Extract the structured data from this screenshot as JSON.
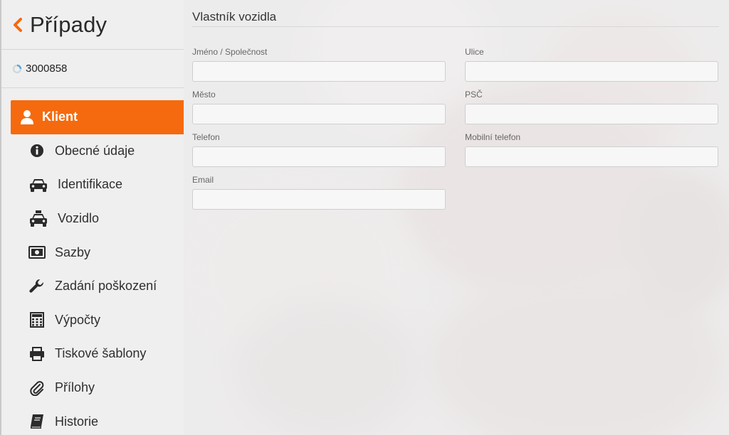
{
  "sidebar": {
    "title": "Případy",
    "case_id": "3000858",
    "items": [
      {
        "label": "Klient",
        "icon": "user-icon",
        "active": true
      },
      {
        "label": "Obecné údaje",
        "icon": "info-circle-icon",
        "active": false
      },
      {
        "label": "Identifikace",
        "icon": "car-icon",
        "active": false
      },
      {
        "label": "Vozidlo",
        "icon": "taxi-icon",
        "active": false
      },
      {
        "label": "Sazby",
        "icon": "money-icon",
        "active": false
      },
      {
        "label": "Zadání poškození",
        "icon": "wrench-icon",
        "active": false
      },
      {
        "label": "Výpočty",
        "icon": "calculator-icon",
        "active": false
      },
      {
        "label": "Tiskové šablony",
        "icon": "print-icon",
        "active": false
      },
      {
        "label": "Přílohy",
        "icon": "paperclip-icon",
        "active": false
      },
      {
        "label": "Historie",
        "icon": "book-icon",
        "active": false
      }
    ]
  },
  "main": {
    "section_title": "Vlastník vozidla",
    "fields": {
      "name": {
        "label": "Jméno / Společnost",
        "value": ""
      },
      "street": {
        "label": "Ulice",
        "value": ""
      },
      "city": {
        "label": "Město",
        "value": ""
      },
      "zip": {
        "label": "PSČ",
        "value": ""
      },
      "phone": {
        "label": "Telefon",
        "value": ""
      },
      "mobile": {
        "label": "Mobilní telefon",
        "value": ""
      },
      "email": {
        "label": "Email",
        "value": ""
      }
    }
  },
  "colors": {
    "accent": "#f56a0e",
    "sidebar_bg": "#f0f0f0",
    "text": "#2f2f2f"
  }
}
